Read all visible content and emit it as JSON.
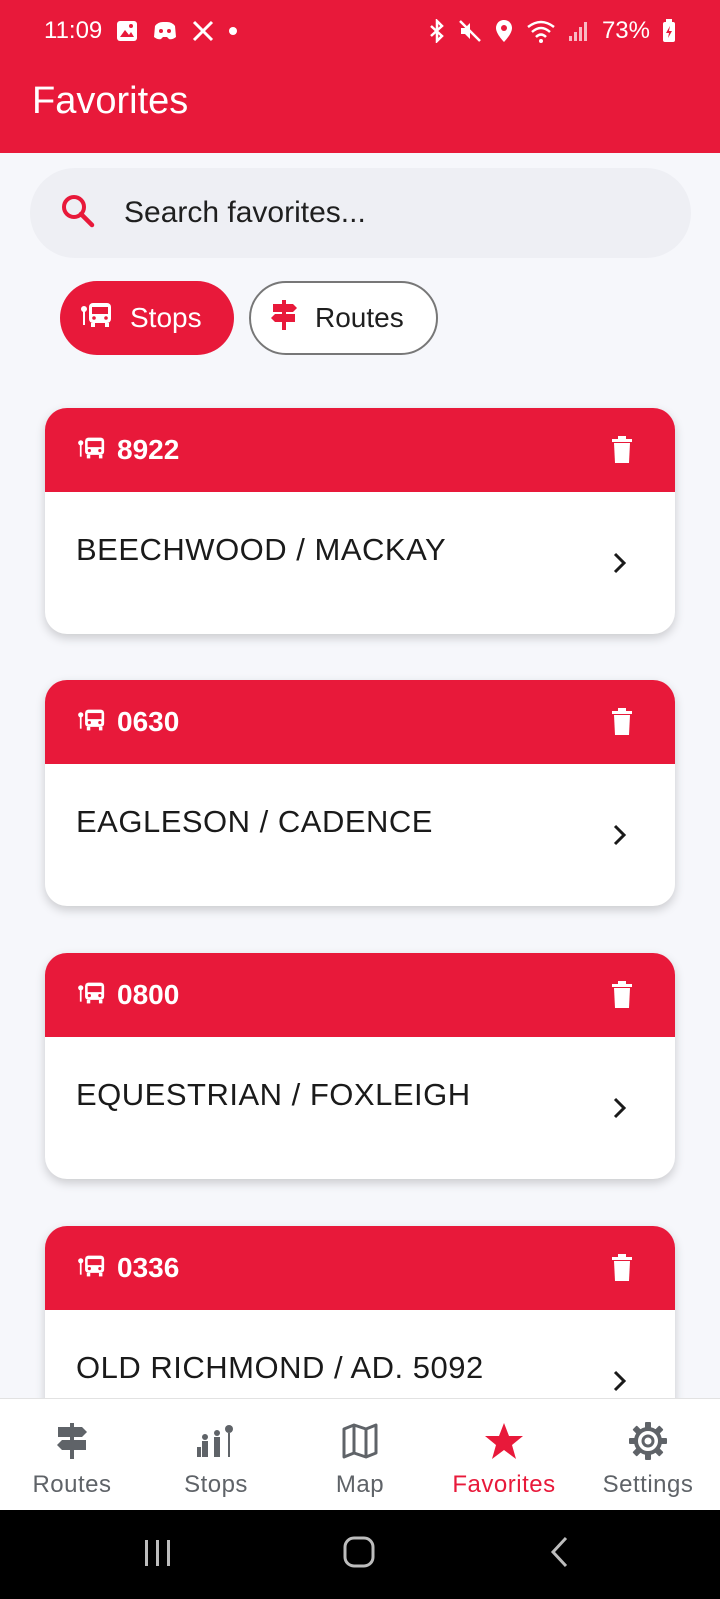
{
  "status_bar": {
    "time": "11:09",
    "battery": "73%",
    "left_icons": [
      "gallery-icon",
      "discord-icon",
      "x-icon",
      "dot-icon"
    ],
    "right_icons": [
      "bluetooth-icon",
      "mute-icon",
      "location-icon",
      "wifi-icon",
      "signal-icon",
      "battery-icon"
    ]
  },
  "app_bar": {
    "title": "Favorites"
  },
  "search": {
    "placeholder": "Search favorites..."
  },
  "filters": [
    {
      "label": "Stops",
      "icon": "bus-stop-icon",
      "selected": true
    },
    {
      "label": "Routes",
      "icon": "signpost-icon",
      "selected": false
    }
  ],
  "favorites": [
    {
      "stop_id": "8922",
      "name": "BEECHWOOD / MACKAY"
    },
    {
      "stop_id": "0630",
      "name": "EAGLESON / CADENCE"
    },
    {
      "stop_id": "0800",
      "name": "EQUESTRIAN / FOXLEIGH"
    },
    {
      "stop_id": "0336",
      "name": "OLD RICHMOND / AD. 5092"
    }
  ],
  "bottom_nav": [
    {
      "label": "Routes",
      "icon": "signpost-icon",
      "active": false
    },
    {
      "label": "Stops",
      "icon": "people-at-stop-icon",
      "active": false
    },
    {
      "label": "Map",
      "icon": "map-icon",
      "active": false
    },
    {
      "label": "Favorites",
      "icon": "star-icon",
      "active": true
    },
    {
      "label": "Settings",
      "icon": "gear-icon",
      "active": false
    }
  ],
  "colors": {
    "primary": "#e8193a",
    "background": "#f6f7fb",
    "inactive_nav": "#5f6368"
  }
}
